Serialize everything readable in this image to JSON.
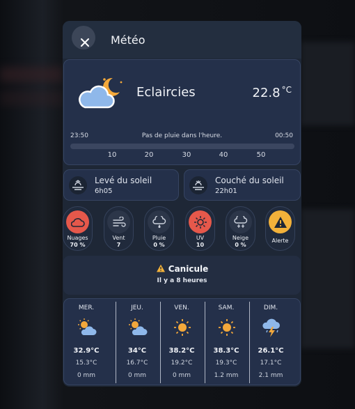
{
  "header": {
    "title": "Météo",
    "close_icon": "close-icon"
  },
  "current": {
    "condition": "Eclaircies",
    "temperature": "22.8",
    "unit": "°C",
    "icon": "partly-cloudy-night-icon",
    "rain_start": "23:50",
    "rain_end": "00:50",
    "rain_message": "Pas de pluie dans l'heure.",
    "rain_ticks": [
      "10",
      "20",
      "30",
      "40",
      "50"
    ]
  },
  "sunrise": {
    "label": "Levé du soleil",
    "time": "6h05"
  },
  "sunset": {
    "label": "Couché du soleil",
    "time": "22h01"
  },
  "stats": [
    {
      "name": "Nuages",
      "value": "70 %",
      "icon": "cloud-icon",
      "color": "#e5584b"
    },
    {
      "name": "Vent",
      "value": "7",
      "icon": "wind-icon",
      "color": "#2c3649"
    },
    {
      "name": "Pluie",
      "value": "0 %",
      "icon": "rain-drop-icon",
      "color": "#2c3649"
    },
    {
      "name": "UV",
      "value": "10",
      "icon": "sun-icon",
      "color": "#e5584b"
    },
    {
      "name": "Neige",
      "value": "0 %",
      "icon": "snow-icon",
      "color": "#2c3649"
    },
    {
      "name": "Alerte",
      "value": "",
      "icon": "warning-icon",
      "color": "#f2b13a"
    }
  ],
  "alert": {
    "title": "Canicule",
    "subtitle": "Il y a 8 heures",
    "icon": "warning-icon"
  },
  "forecast": [
    {
      "day": "MER.",
      "high": "32.9°C",
      "low": "15.3°C",
      "rain": "0 mm",
      "icon": "sun-cloud-icon"
    },
    {
      "day": "JEU.",
      "high": "34°C",
      "low": "16.7°C",
      "rain": "0 mm",
      "icon": "sun-cloud-icon"
    },
    {
      "day": "VEN.",
      "high": "38.2°C",
      "low": "19.2°C",
      "rain": "0 mm",
      "icon": "sun-icon"
    },
    {
      "day": "SAM.",
      "high": "38.3°C",
      "low": "19.3°C",
      "rain": "1.2 mm",
      "icon": "sun-icon"
    },
    {
      "day": "DIM.",
      "high": "26.1°C",
      "low": "17.1°C",
      "rain": "2.1 mm",
      "icon": "thunderstorm-icon"
    }
  ],
  "colors": {
    "panel": "#1e2736",
    "card": "#24304a",
    "accent_red": "#e5584b",
    "accent_yellow": "#f2b13a",
    "sun": "#f3a83b",
    "cloud": "#8fb8ea"
  }
}
